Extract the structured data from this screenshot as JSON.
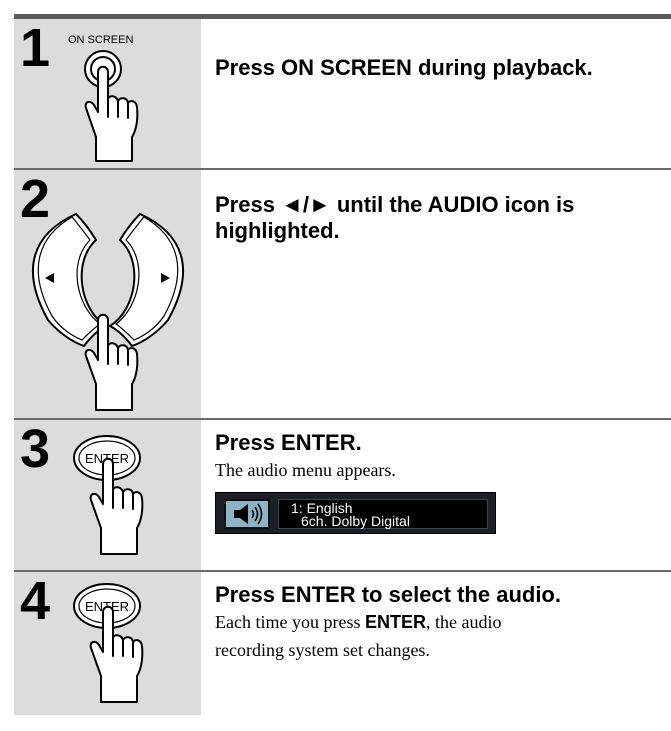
{
  "steps": [
    {
      "number": "1",
      "button_label": "ON SCREEN",
      "title": "Press ON SCREEN during playback."
    },
    {
      "number": "2",
      "title_line1": "Press ◄/► until the AUDIO icon is",
      "title_line2": "highlighted."
    },
    {
      "number": "3",
      "button_label": "ENTER",
      "title": "Press ENTER.",
      "body": "The audio menu appears.",
      "osd": {
        "line1": "1: English",
        "line2": "6ch. Dolby Digital"
      }
    },
    {
      "number": "4",
      "button_label": "ENTER",
      "title": "Press ENTER to select the audio.",
      "body_pre": "Each time you press ",
      "body_bold": "ENTER",
      "body_post": ", the audio recording system set changes."
    }
  ],
  "icons": [
    "hand-icon",
    "left-arrow-icon",
    "right-arrow-icon",
    "speaker-icon"
  ],
  "colors": {
    "left_panel": "#dcdcdc",
    "divider": "#6a6a6a",
    "osd_icon_bg": "#8db3c5",
    "osd_bg": "#1b2026"
  }
}
